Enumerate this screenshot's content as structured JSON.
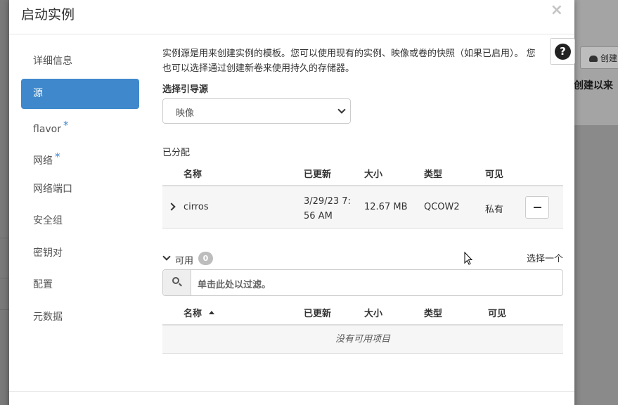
{
  "modal": {
    "title": "启动实例",
    "close": "×"
  },
  "nav": {
    "items": [
      {
        "label": "详细信息",
        "required": false,
        "active": false
      },
      {
        "label": "源",
        "required": false,
        "active": true
      },
      {
        "label": "flavor",
        "required": true,
        "active": false
      },
      {
        "label": "网络",
        "required": true,
        "active": false
      },
      {
        "label": "网络端口",
        "required": false,
        "active": false
      },
      {
        "label": "安全组",
        "required": false,
        "active": false
      },
      {
        "label": "密钥对",
        "required": false,
        "active": false
      },
      {
        "label": "配置",
        "required": false,
        "active": false
      },
      {
        "label": "元数据",
        "required": false,
        "active": false
      }
    ],
    "required_mark": "*"
  },
  "source": {
    "description": "实例源是用来创建实例的模板。您可以使用现有的实例、映像或卷的快照（如果已启用）。 您也可以选择通过创建新卷来使用持久的存储器。",
    "boot_source_label": "选择引导源",
    "boot_source_value": "映像",
    "help": "?"
  },
  "allocated": {
    "label": "已分配",
    "columns": {
      "name": "名称",
      "updated": "已更新",
      "size": "大小",
      "type": "类型",
      "visibility": "可见"
    },
    "rows": [
      {
        "name": "cirros",
        "updated_line1": "3/29/23 7:",
        "updated_line2": "56 AM",
        "size": "12.67 MB",
        "type": "QCOW2",
        "visibility": "私有"
      }
    ]
  },
  "available": {
    "label": "可用",
    "count": "0",
    "select_one": "选择一个",
    "filter_placeholder": "单击此处以过滤。",
    "columns": {
      "name": "名称",
      "updated": "已更新",
      "size": "大小",
      "type": "类型",
      "visibility": "可见"
    },
    "empty": "没有可用项目"
  },
  "background": {
    "button": "创建",
    "text": "创建以来"
  }
}
